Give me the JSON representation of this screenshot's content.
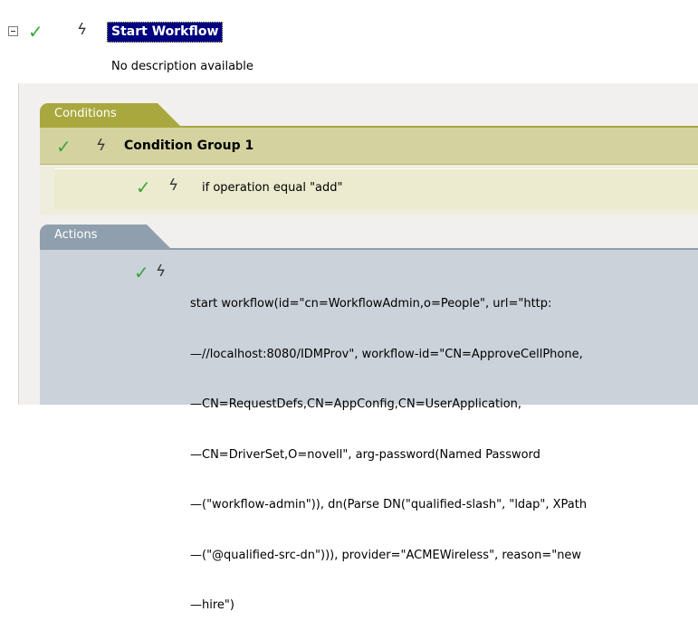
{
  "rule": {
    "title": "Start Workflow",
    "description": "No description available",
    "expander_icon": "minus-box-icon",
    "enabled_icon": "checkmark-icon",
    "token_icon": "lightning-icon"
  },
  "conditions": {
    "tab_label": "Conditions",
    "group_label": "Condition Group 1",
    "expression": "if operation equal \"add\""
  },
  "actions": {
    "tab_label": "Actions",
    "lines": [
      "start workflow(id=\"cn=WorkflowAdmin,o=People\", url=\"http:",
      "—//localhost:8080/IDMProv\", workflow-id=\"CN=ApproveCellPhone,",
      "—CN=RequestDefs,CN=AppConfig,CN=UserApplication,",
      "—CN=DriverSet,O=novell\", arg-password(Named Password",
      "—(\"workflow-admin\")), dn(Parse DN(\"qualified-slash\", \"ldap\", XPath",
      "—(\"@qualified-src-dn\"))), provider=\"ACMEWireless\", reason=\"new",
      "—hire\")"
    ]
  },
  "colors": {
    "title_highlight": "#000080",
    "conditions_tab": "#a9a83f",
    "conditions_group": "#d4d3a0",
    "actions_tab": "#8f9fae",
    "actions_body": "#cbd2da",
    "check": "#3aa63a"
  }
}
